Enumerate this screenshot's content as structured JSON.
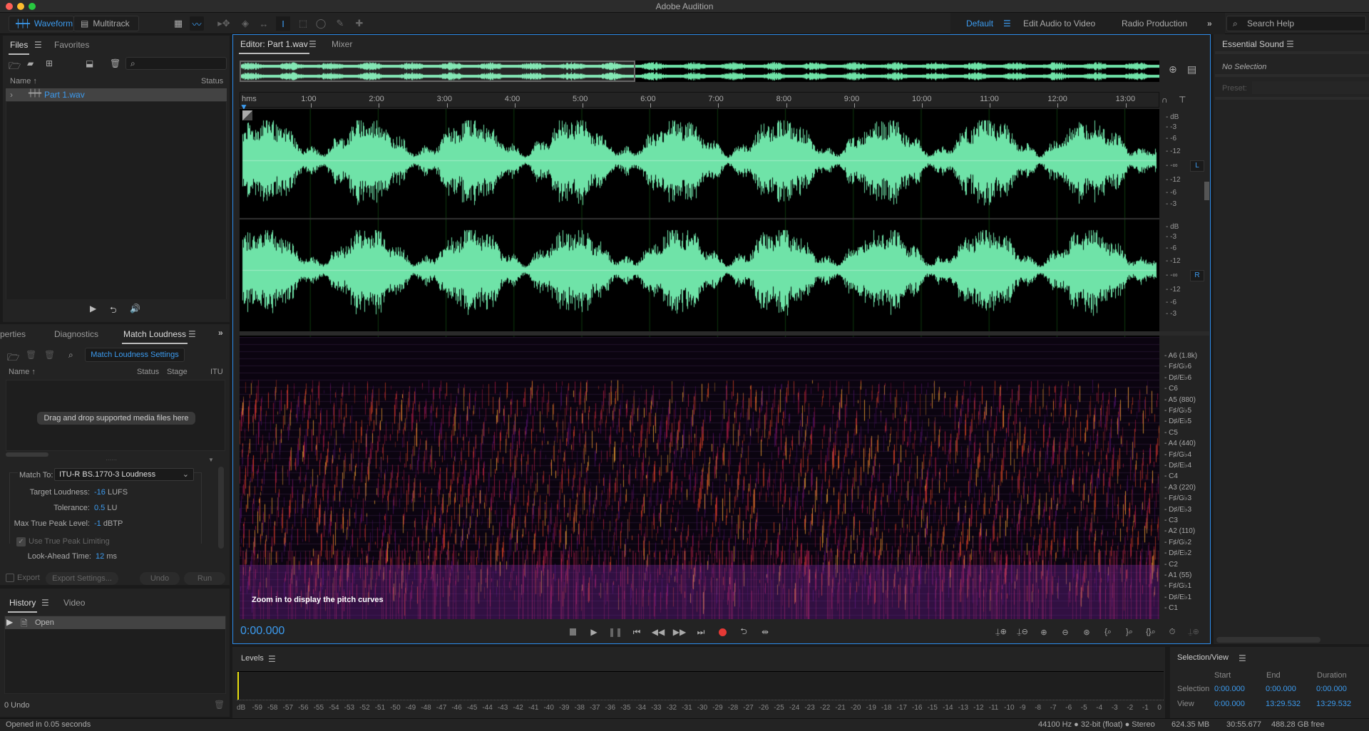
{
  "app": {
    "title": "Adobe Audition"
  },
  "toolbar": {
    "modes": [
      {
        "label": "Waveform",
        "icon": "waveform-icon",
        "active": true
      },
      {
        "label": "Multitrack",
        "icon": "multitrack-icon",
        "active": false
      }
    ],
    "tools": [
      "spectral-frequency-display-icon",
      "waveform-display-icon",
      "move-tool-icon",
      "razor-tool-icon",
      "slip-tool-icon",
      "time-selection-tool-icon",
      "marquee-selection-tool-icon",
      "lasso-selection-tool-icon",
      "paintbrush-selection-tool-icon",
      "spot-healing-brush-icon"
    ],
    "workspaces": [
      {
        "label": "Default",
        "active": true
      },
      {
        "label": "Edit Audio to Video"
      },
      {
        "label": "Radio Production"
      }
    ],
    "more": "»",
    "search_placeholder": "Search Help"
  },
  "files_panel": {
    "tabs": [
      "Files",
      "Favorites"
    ],
    "columns": [
      "Name ↑",
      "Status"
    ],
    "files": [
      {
        "name": "Part 1.wav",
        "status": ""
      }
    ],
    "accent": "#3c9bef"
  },
  "match_loudness_panel": {
    "tabs": [
      "perties",
      "Diagnostics",
      "Match Loudness"
    ],
    "settings_button": "Match Loudness Settings",
    "columns": [
      "Name ↑",
      "Status",
      "Stage",
      "ITU"
    ],
    "drop_hint": "Drag and drop supported media files here",
    "match_to_label": "Match To:",
    "match_to_value": "ITU-R BS.1770-3 Loudness",
    "fields": [
      {
        "label": "Target Loudness:",
        "value": "-16",
        "unit": "LUFS"
      },
      {
        "label": "Tolerance:",
        "value": "0.5",
        "unit": "LU"
      },
      {
        "label": "Max True Peak Level:",
        "value": "-1",
        "unit": "dBTP"
      }
    ],
    "use_true_peak_label": "Use True Peak Limiting",
    "use_true_peak_checked": true,
    "lookahead_label": "Look-Ahead Time:",
    "lookahead_value": "12",
    "lookahead_unit": "ms",
    "export_label": "Export",
    "export_settings_label": "Export Settings...",
    "undo_label": "Undo",
    "run_label": "Run"
  },
  "history_panel": {
    "tabs": [
      "History",
      "Video"
    ],
    "items": [
      "Open"
    ],
    "undo_count": "0 Undo"
  },
  "status_left": "Opened in 0.05 seconds",
  "editor": {
    "tabs": [
      "Editor: Part 1.wav",
      "Mixer"
    ],
    "ruler_unit": "hms",
    "ruler_labels": [
      "1:00",
      "2:00",
      "3:00",
      "4:00",
      "5:00",
      "6:00",
      "7:00",
      "8:00",
      "9:00",
      "10:00",
      "11:00",
      "12:00",
      "13:00"
    ],
    "db_scale": [
      "dB",
      "-3",
      "-6",
      "-12",
      "-∞",
      "-12",
      "-6",
      "-3"
    ],
    "channels": [
      "L",
      "R"
    ],
    "pitch_labels": [
      "A6 (1.8k)",
      "F♯/G♭6",
      "D♯/E♭6",
      "C6",
      "A5 (880)",
      "F♯/G♭5",
      "D♯/E♭5",
      "C5",
      "A4 (440)",
      "F♯/G♭4",
      "D♯/E♭4",
      "C4",
      "A3 (220)",
      "F♯/G♭3",
      "D♯/E♭3",
      "C3",
      "A2 (110)",
      "F♯/G♭2",
      "D♯/E♭2",
      "C2",
      "A1 (55)",
      "F♯/G♭1",
      "D♯/E♭1",
      "C1"
    ],
    "pitch_hint": "Zoom in to display the pitch curves",
    "current_time": "0:00.000",
    "waveform_color": "#6fe3a8",
    "overview_visible_fraction": 0.43
  },
  "essential_sound": {
    "title": "Essential Sound",
    "no_selection": "No Selection",
    "preset_label": "Preset:"
  },
  "levels": {
    "title": "Levels",
    "ticks": [
      "dB",
      "-59",
      "-58",
      "-57",
      "-56",
      "-55",
      "-54",
      "-53",
      "-52",
      "-51",
      "-50",
      "-49",
      "-48",
      "-47",
      "-46",
      "-45",
      "-44",
      "-43",
      "-42",
      "-41",
      "-40",
      "-39",
      "-38",
      "-37",
      "-36",
      "-35",
      "-34",
      "-33",
      "-32",
      "-31",
      "-30",
      "-29",
      "-28",
      "-27",
      "-26",
      "-25",
      "-24",
      "-23",
      "-22",
      "-21",
      "-20",
      "-19",
      "-18",
      "-17",
      "-16",
      "-15",
      "-14",
      "-13",
      "-12",
      "-11",
      "-10",
      "-9",
      "-8",
      "-7",
      "-6",
      "-5",
      "-4",
      "-3",
      "-2",
      "-1",
      "0"
    ]
  },
  "selection_view": {
    "title": "Selection/View",
    "columns": [
      "Start",
      "End",
      "Duration"
    ],
    "rows": [
      {
        "label": "Selection",
        "start": "0:00.000",
        "end": "0:00.000",
        "duration": "0:00.000"
      },
      {
        "label": "View",
        "start": "0:00.000",
        "end": "13:29.532",
        "duration": "13:29.532"
      }
    ]
  },
  "status_bar": {
    "format": "44100 Hz ● 32-bit (float) ● Stereo",
    "size": "624.35 MB",
    "duration": "30:55.677",
    "free": "488.28 GB free"
  }
}
